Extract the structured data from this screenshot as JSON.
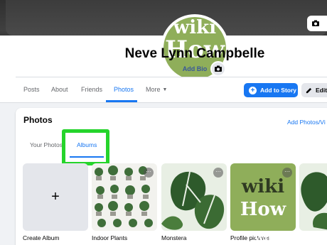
{
  "profile": {
    "avatar_text": [
      "wiki",
      "How"
    ],
    "name": "Neve Lynn Campbelle",
    "add_bio": "Add Bio"
  },
  "cover": {
    "edit_icon": "camera-icon"
  },
  "nav": {
    "items": [
      {
        "label": "Posts",
        "active": false
      },
      {
        "label": "About",
        "active": false
      },
      {
        "label": "Friends",
        "active": false
      },
      {
        "label": "Photos",
        "active": true
      },
      {
        "label": "More",
        "active": false
      }
    ],
    "add_story": "Add to Story",
    "edit": "Edit"
  },
  "photos": {
    "title": "Photos",
    "add_link": "Add Photos/Vi",
    "tabs": [
      {
        "label": "Your Photos",
        "active": false
      },
      {
        "label": "Albums",
        "active": true
      }
    ],
    "highlight_color": "#25d42b",
    "albums": [
      {
        "label": "Create Album"
      },
      {
        "label": "Indoor Plants"
      },
      {
        "label": "Monstera"
      },
      {
        "label": "Profile pictures"
      },
      {
        "label": ""
      }
    ],
    "wikihow_text": [
      "wiki",
      "How"
    ]
  },
  "watermark": "wikiHow",
  "colors": {
    "accent": "#1877f2",
    "page_bg": "#f0f2f5"
  }
}
